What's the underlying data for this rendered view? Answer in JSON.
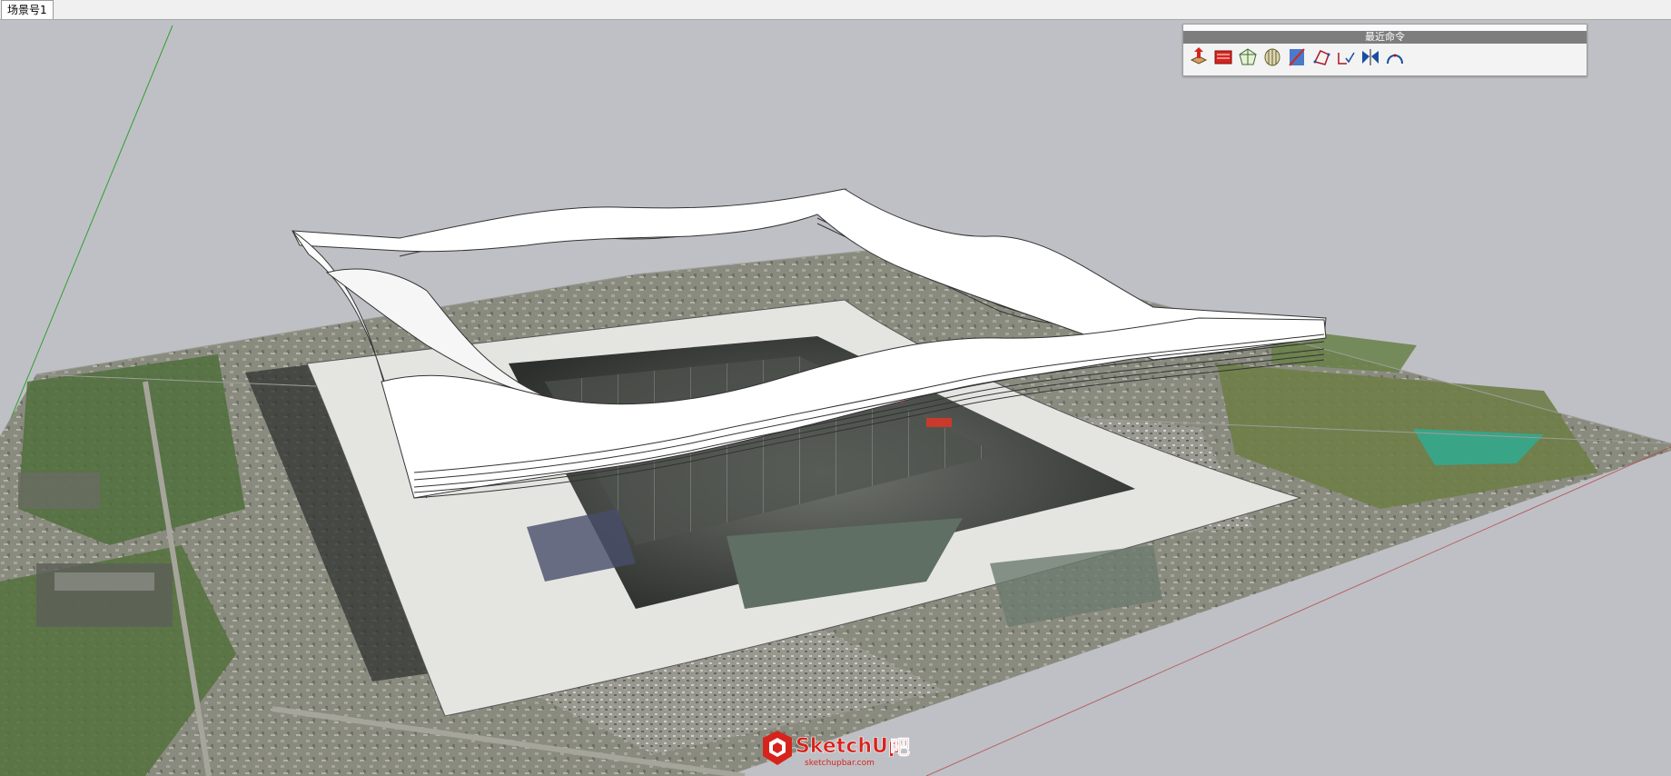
{
  "scene_tabs": [
    {
      "label": "场景号1",
      "active": true
    }
  ],
  "recent_commands_panel": {
    "title": "最近命令",
    "tools": [
      {
        "name": "push-pull-icon"
      },
      {
        "name": "follow-me-icon"
      },
      {
        "name": "soften-edges-icon"
      },
      {
        "name": "curviloft-icon"
      },
      {
        "name": "section-plane-icon"
      },
      {
        "name": "polygon-icon"
      },
      {
        "name": "check-curve-icon"
      },
      {
        "name": "mirror-icon"
      },
      {
        "name": "arc-icon"
      }
    ]
  },
  "watermark": {
    "brand": "SketchUp",
    "suffix": "吧",
    "url": "sketchupbar.com"
  },
  "colors": {
    "sky": "#bfc0c5",
    "model_surface": "#ffffff",
    "green_axis": "#2fa12f",
    "red_axis": "#c43a3a",
    "brand_red": "#d6241d"
  }
}
